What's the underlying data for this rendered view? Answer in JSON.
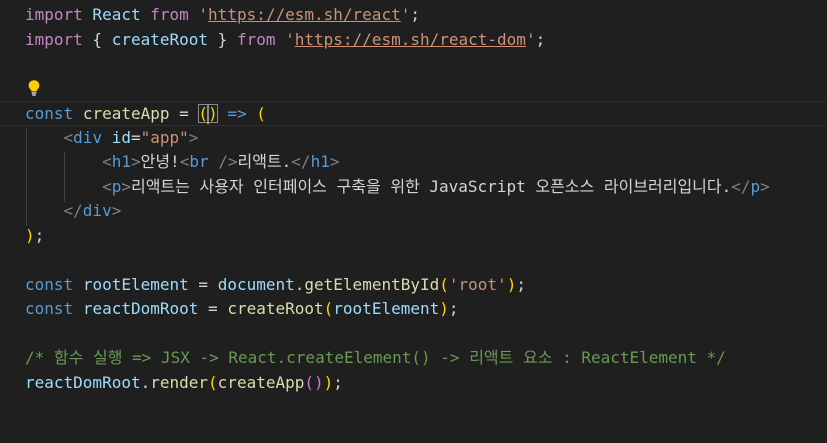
{
  "editor": {
    "language": "javascript",
    "colors": {
      "background": "#1f1f1f",
      "keyword": "#c586c0",
      "storage": "#569cd6",
      "variable": "#9cdcfe",
      "function": "#dcdcaa",
      "string": "#ce9178",
      "comment": "#6a9955",
      "lightbulb": "#ffcc00"
    },
    "lightbulb_icon": "lightbulb-icon",
    "lines": {
      "l1": {
        "t1": "import",
        "t2": " React ",
        "t3": "from",
        "t4": " ",
        "t5": "'",
        "t6": "https://esm.sh/react",
        "t7": "'",
        "t8": ";"
      },
      "l2": {
        "t1": "import",
        "t2": " { ",
        "t3": "createRoot",
        "t4": " } ",
        "t5": "from",
        "t6": " ",
        "t7": "'",
        "t8": "https://esm.sh/react-dom",
        "t9": "'",
        "t10": ";"
      },
      "l5": {
        "t1": "const",
        "t2": " ",
        "t3": "createApp",
        "t4": " = ",
        "t5": "(",
        "t6": ")",
        "t7": " => ",
        "t8": "("
      },
      "l6": {
        "t1": "<",
        "t2": "div",
        "t3": " ",
        "t4": "id",
        "t5": "=",
        "t6": "\"app\"",
        "t7": ">"
      },
      "l7": {
        "t1": "<",
        "t2": "h1",
        "t3": ">",
        "t4": "안녕!",
        "t5": "<",
        "t6": "br",
        "t7": " />",
        "t8": "리액트.",
        "t9": "</",
        "t10": "h1",
        "t11": ">"
      },
      "l8": {
        "t1": "<",
        "t2": "p",
        "t3": ">",
        "t4": "리액트는 사용자 인터페이스 구축을 위한 JavaScript 오픈소스 라이브러리입니다.",
        "t5": "</",
        "t6": "p",
        "t7": ">"
      },
      "l9": {
        "t1": "</",
        "t2": "div",
        "t3": ">"
      },
      "l10": {
        "t1": ")",
        "t2": ";"
      },
      "l12": {
        "t1": "const",
        "t2": " ",
        "t3": "rootElement",
        "t4": " = ",
        "t5": "document",
        "t6": ".",
        "t7": "getElementById",
        "t8": "(",
        "t9": "'root'",
        "t10": ")",
        "t11": ";"
      },
      "l13": {
        "t1": "const",
        "t2": " ",
        "t3": "reactDomRoot",
        "t4": " = ",
        "t5": "createRoot",
        "t6": "(",
        "t7": "rootElement",
        "t8": ")",
        "t9": ";"
      },
      "l15": {
        "t1": "/* 함수 실행 => JSX -> React.createElement() -> 리액트 요소 : ReactElement */"
      },
      "l16": {
        "t1": "reactDomRoot",
        "t2": ".",
        "t3": "render",
        "t4": "(",
        "t5": "createApp",
        "t6": "(",
        "t7": ")",
        "t8": ")",
        "t9": ";"
      }
    }
  }
}
